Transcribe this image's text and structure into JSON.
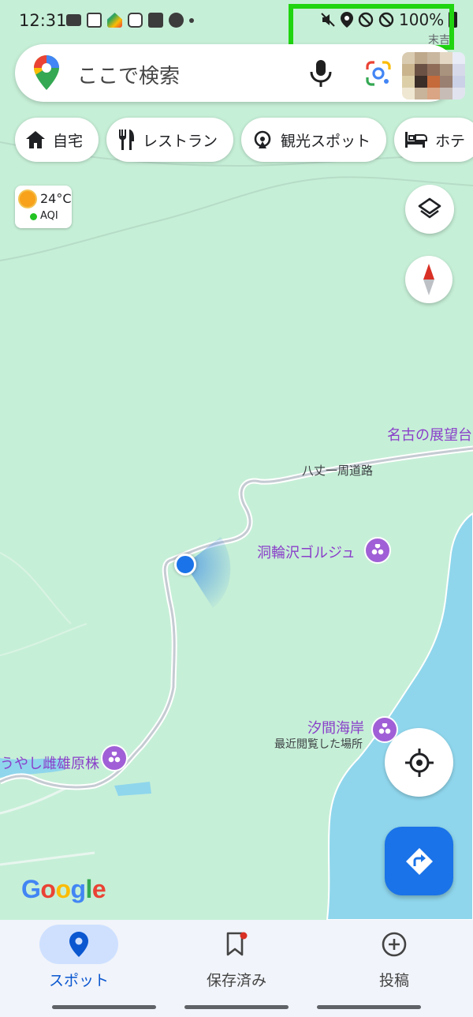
{
  "status_bar": {
    "time": "12:31",
    "battery": "100%",
    "notification_icons": [
      "gmail-icon",
      "calendar-icon",
      "google-home-icon",
      "instagram-icon",
      "calendar-14-icon",
      "messenger-icon",
      "more-dot-icon"
    ],
    "system_icons": [
      "mute-icon",
      "location-icon",
      "block-icon",
      "block-icon",
      "battery-icon"
    ],
    "highlight_color": "#1fd50f"
  },
  "search": {
    "placeholder": "ここで検索",
    "partial_top_label": "末吉"
  },
  "chips": [
    {
      "label": "自宅",
      "icon": "home-icon"
    },
    {
      "label": "レストラン",
      "icon": "restaurant-icon"
    },
    {
      "label": "観光スポット",
      "icon": "attractions-icon"
    },
    {
      "label": "ホテ",
      "icon": "hotel-icon"
    }
  ],
  "weather": {
    "temperature": "24°C",
    "aqi_label": "AQI",
    "aqi_color": "#22c322"
  },
  "map": {
    "road_label": "八丈一周道路",
    "places": [
      {
        "name": "名古の展望台"
      },
      {
        "name": "洞輪沢ゴルジュ"
      },
      {
        "name": "汐間海岸",
        "sub": "最近閲覧した場所"
      },
      {
        "name": "うやし雌雄原株"
      }
    ],
    "watermark": "Google",
    "land_color": "#c6efd7",
    "sea_color": "#8fd6ec",
    "location_dot_color": "#1a73e8"
  },
  "nav": [
    {
      "label": "スポット",
      "icon": "location-pin-icon",
      "active": true
    },
    {
      "label": "保存済み",
      "icon": "bookmark-icon",
      "active": false
    },
    {
      "label": "投稿",
      "icon": "add-circle-icon",
      "active": false
    }
  ],
  "colors": {
    "accent": "#1a73e8",
    "poi": "#a05fd6",
    "nav_active_bg": "#cfe0ff"
  }
}
